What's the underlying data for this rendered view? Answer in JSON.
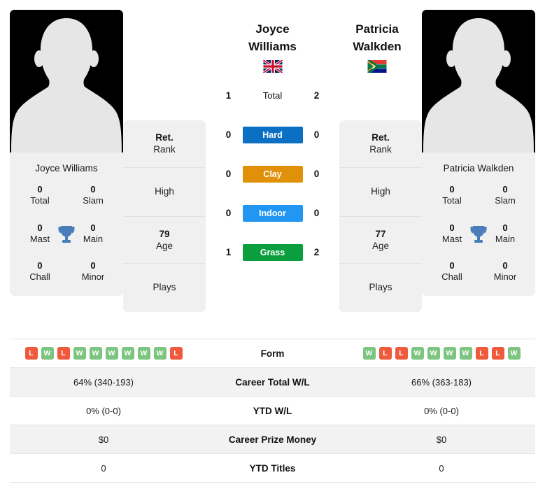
{
  "left_player": {
    "name": "Joyce Williams",
    "country_code": "GB",
    "country_flag_icon": "flag-uk-icon",
    "avatar_icon": "player-silhouette-icon",
    "titles": {
      "total": {
        "value": "0",
        "label": "Total"
      },
      "slam": {
        "value": "0",
        "label": "Slam"
      },
      "mast": {
        "value": "0",
        "label": "Mast"
      },
      "main": {
        "value": "0",
        "label": "Main"
      },
      "chall": {
        "value": "0",
        "label": "Chall"
      },
      "minor": {
        "value": "0",
        "label": "Minor"
      }
    },
    "info": {
      "rank_value": "Ret.",
      "rank_label": "Rank",
      "high_label": "High",
      "age_value": "79",
      "age_label": "Age",
      "plays_label": "Plays"
    },
    "form": [
      "L",
      "W",
      "L",
      "W",
      "W",
      "W",
      "W",
      "W",
      "W",
      "L"
    ],
    "career_total_wl": "64% (340-193)",
    "ytd_wl": "0% (0-0)",
    "career_prize_money": "$0",
    "ytd_titles": "0"
  },
  "right_player": {
    "name": "Patricia Walkden",
    "country_code": "ZA",
    "country_flag_icon": "flag-south-africa-icon",
    "avatar_icon": "player-silhouette-icon",
    "titles": {
      "total": {
        "value": "0",
        "label": "Total"
      },
      "slam": {
        "value": "0",
        "label": "Slam"
      },
      "mast": {
        "value": "0",
        "label": "Mast"
      },
      "main": {
        "value": "0",
        "label": "Main"
      },
      "chall": {
        "value": "0",
        "label": "Chall"
      },
      "minor": {
        "value": "0",
        "label": "Minor"
      }
    },
    "info": {
      "rank_value": "Ret.",
      "rank_label": "Rank",
      "high_label": "High",
      "age_value": "77",
      "age_label": "Age",
      "plays_label": "Plays"
    },
    "form": [
      "W",
      "L",
      "L",
      "W",
      "W",
      "W",
      "W",
      "L",
      "L",
      "W"
    ],
    "career_total_wl": "66% (363-183)",
    "ytd_wl": "0% (0-0)",
    "career_prize_money": "$0",
    "ytd_titles": "0"
  },
  "head_to_head": {
    "rows": [
      {
        "label": "Total",
        "left": "1",
        "right": "2",
        "color": "none"
      },
      {
        "label": "Hard",
        "left": "0",
        "right": "0",
        "color": "#0b6fc4"
      },
      {
        "label": "Clay",
        "left": "0",
        "right": "0",
        "color": "#e09009"
      },
      {
        "label": "Indoor",
        "left": "0",
        "right": "0",
        "color": "#2196f3"
      },
      {
        "label": "Grass",
        "left": "1",
        "right": "2",
        "color": "#0a9e3f"
      }
    ]
  },
  "stats_rows": [
    {
      "label": "Form",
      "left": "",
      "right": ""
    },
    {
      "label": "Career Total W/L",
      "left": "64% (340-193)",
      "right": "66% (363-183)"
    },
    {
      "label": "YTD W/L",
      "left": "0% (0-0)",
      "right": "0% (0-0)"
    },
    {
      "label": "Career Prize Money",
      "left": "$0",
      "right": "$0"
    },
    {
      "label": "YTD Titles",
      "left": "0",
      "right": "0"
    }
  ],
  "colors": {
    "hard": "#0b6fc4",
    "clay": "#e09009",
    "indoor": "#2196f3",
    "grass": "#0a9e3f",
    "win": "#7cc47f",
    "loss": "#ef5a3d",
    "trophy": "#4a7ebb",
    "card_bg": "#f0f0f0",
    "row_alt_bg": "#f2f2f2"
  }
}
